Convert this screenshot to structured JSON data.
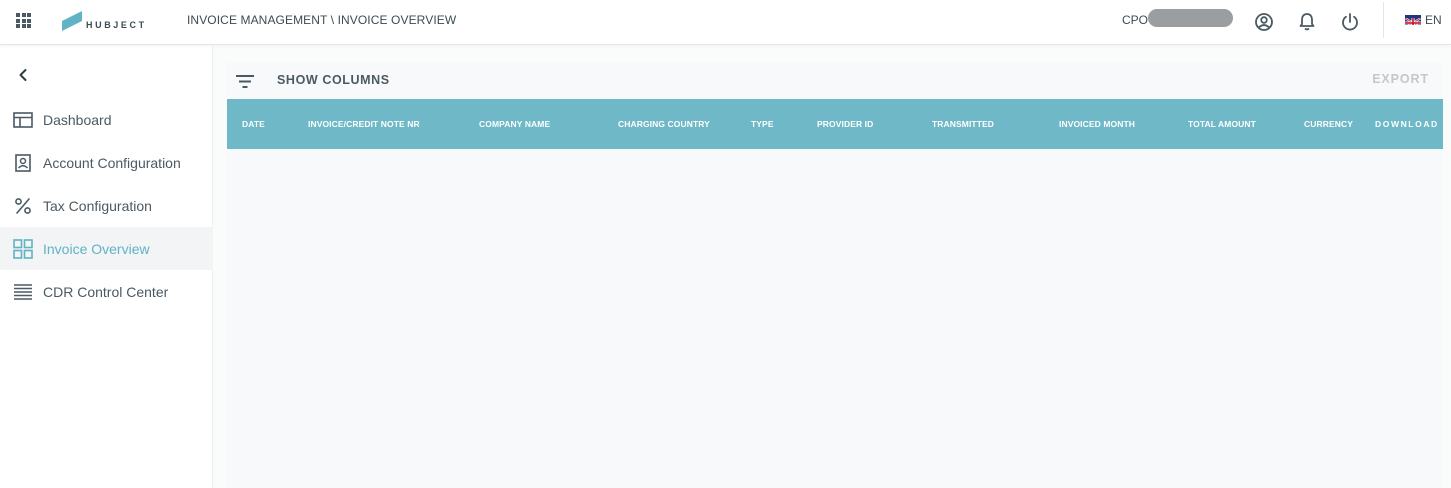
{
  "header": {
    "logo_text": "HUBJECT",
    "breadcrumb": "INVOICE MANAGEMENT \\ INVOICE OVERVIEW",
    "cpo_label": "CPO",
    "language": "EN"
  },
  "sidebar": {
    "items": [
      {
        "label": "Dashboard",
        "icon": "dashboard-icon",
        "active": false
      },
      {
        "label": "Account Configuration",
        "icon": "account-config-icon",
        "active": false
      },
      {
        "label": "Tax Configuration",
        "icon": "percent-icon",
        "active": false
      },
      {
        "label": "Invoice Overview",
        "icon": "grid-icon",
        "active": true
      },
      {
        "label": "CDR Control Center",
        "icon": "list-icon",
        "active": false
      }
    ]
  },
  "toolbar": {
    "show_columns": "SHOW COLUMNS",
    "export": "EXPORT"
  },
  "table": {
    "columns": [
      "DATE",
      "INVOICE/CREDIT NOTE NR",
      "COMPANY NAME",
      "CHARGING COUNTRY",
      "TYPE",
      "PROVIDER ID",
      "TRANSMITTED",
      "INVOICED MONTH",
      "TOTAL AMOUNT",
      "CURRENCY",
      "DOWNLOAD"
    ],
    "rows": []
  },
  "colors": {
    "accent": "#5fb3c4",
    "table_header": "#6fb8c7",
    "text": "#3d4b52"
  }
}
